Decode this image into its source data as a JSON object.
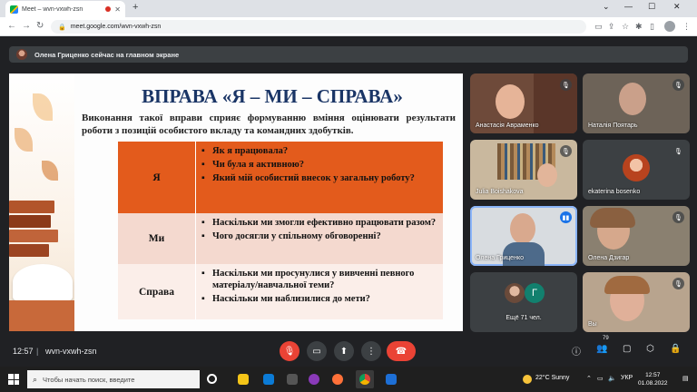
{
  "browser": {
    "tab_title": "Meet – wvn-vxwh-zsn",
    "new_tab_glyph": "+",
    "url": "meet.google.com/wvn-vxwh-zsn"
  },
  "banner": {
    "text": "Олена Гриценко сейчас на главном экране"
  },
  "slide": {
    "title": "ВПРАВА «Я – МИ – СПРАВА»",
    "description": "Виконання такої вправи сприяє формуванню вміння оцінювати результати роботи з позицій особистого вкладу та командних здобутків.",
    "rows": [
      {
        "label": "Я",
        "items": [
          "Як я працювала?",
          "Чи була я активною?",
          "Який мій особистий внесок у загальну роботу?"
        ]
      },
      {
        "label": "Ми",
        "items": [
          "Наскільки ми змогли ефективно працювати разом?",
          "Чого досягли у спільному обговоренні?"
        ]
      },
      {
        "label": "Справа",
        "items": [
          "Наскільки ми просунулися у вивченні певного матеріалу/навчальної теми?",
          "Наскільки ми наблизилися до мети?"
        ]
      }
    ]
  },
  "participants": [
    {
      "name": "Анастасія Авраменко",
      "muted": true
    },
    {
      "name": "Наталія Поятарь",
      "muted": true
    },
    {
      "name": "Julia Boishakova",
      "muted": true
    },
    {
      "name": "ekaterina bosenko",
      "muted": true
    },
    {
      "name": "Олена Гриценко",
      "muted": false
    },
    {
      "name": "Олена Дзигар",
      "muted": true
    },
    {
      "name": "Ещё 71 чел.",
      "avatar_letter": "Г"
    },
    {
      "name": "Вы",
      "muted": true
    }
  ],
  "meeting": {
    "time": "12:57",
    "separator": "|",
    "code": "wvn-vxwh-zsn",
    "participant_count": "79"
  },
  "taskbar": {
    "search_placeholder": "Чтобы начать поиск, введите",
    "weather": "22°C Sunny",
    "language": "УКР",
    "time": "12:57",
    "date": "01.08.2022"
  },
  "colors": {
    "accent_blue": "#1a73e8",
    "end_call_red": "#d93025",
    "mic_off_red": "#ea4335",
    "slide_orange": "#e35b1c",
    "slide_title_blue": "#1a3566"
  },
  "icons": [
    "mic-off-icon",
    "camera-icon",
    "present-icon",
    "more-icon",
    "end-call-icon",
    "info-icon",
    "people-icon",
    "chat-icon",
    "activities-icon",
    "lock-icon"
  ]
}
